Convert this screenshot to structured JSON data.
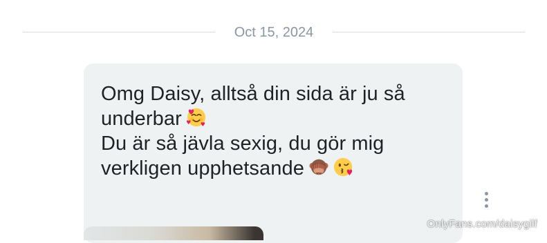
{
  "date_separator": {
    "label": "Oct 15, 2024"
  },
  "message": {
    "lines": [
      "Omg Daisy, alltså din sida är ju så",
      "underbar",
      "Du är så jävla sexig, du gör mig",
      "verkligen upphetsande"
    ],
    "emojis": [
      "smiling-face-with-hearts-icon",
      "see-no-evil-monkey-icon",
      "face-blowing-kiss-icon"
    ]
  },
  "watermark": {
    "text": "OnlyFans.com/daisygilf"
  },
  "colors": {
    "bubble_bg": "#eef2f2",
    "text": "#1d2226",
    "muted": "#8a96a3"
  }
}
